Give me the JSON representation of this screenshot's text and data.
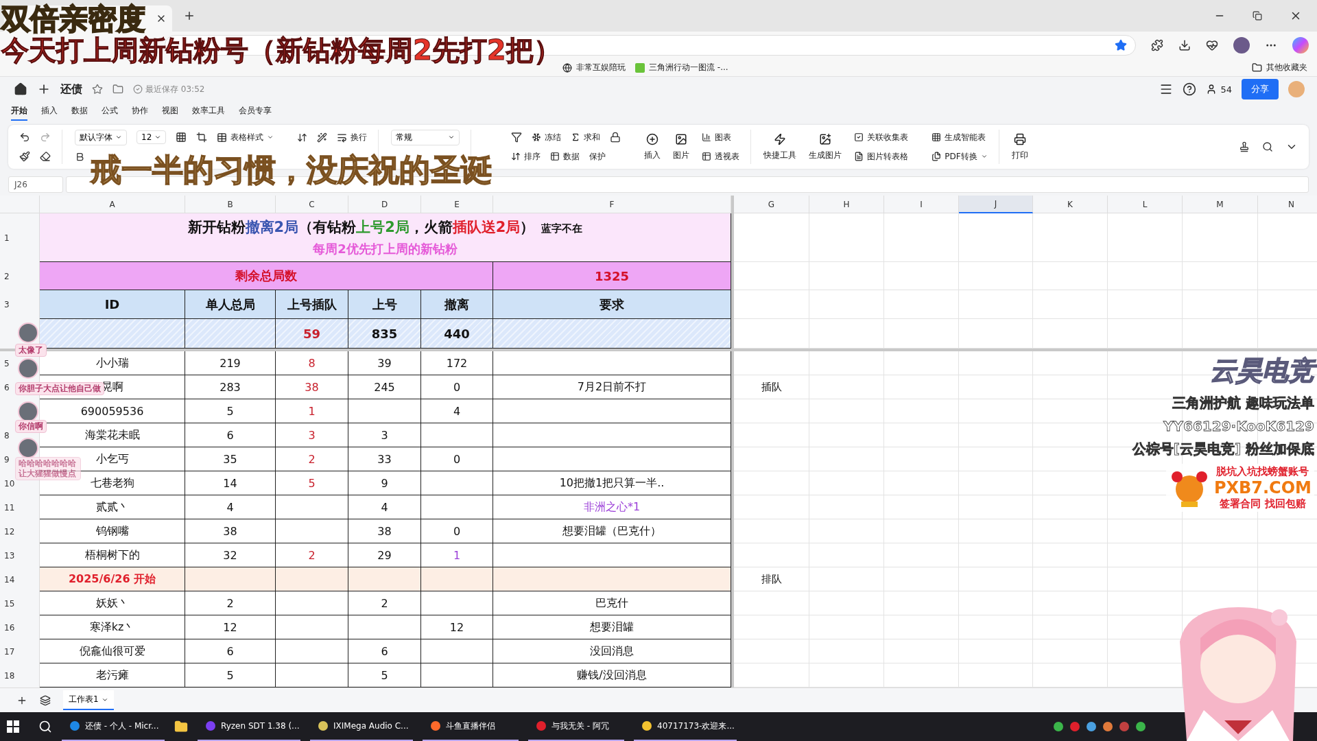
{
  "captions": [
    {
      "kind": "headline",
      "text": "双倍亲密度"
    },
    {
      "kind": "subline",
      "text": "今天打上周新钻粉号（新钻粉每周2先打2把）"
    },
    {
      "kind": "lyric",
      "text": "戒一半的习惯，没庆祝的圣诞"
    }
  ],
  "browser": {
    "bookmarks": [
      "非常互娱陪玩",
      "三角洲行动一图流 -..."
    ],
    "other_bookmarks": "其他收藏夹"
  },
  "doc": {
    "title": "还债",
    "saved": "最近保存 03:52",
    "collaborators": "54",
    "share": "分享"
  },
  "menu_tabs": [
    {
      "label": "开始",
      "selected": true
    },
    {
      "label": "插入",
      "selected": false
    },
    {
      "label": "数据",
      "selected": false
    },
    {
      "label": "公式",
      "selected": false
    },
    {
      "label": "协作",
      "selected": false
    },
    {
      "label": "视图",
      "selected": false
    },
    {
      "label": "效率工具",
      "selected": false
    },
    {
      "label": "会员专享",
      "selected": false
    }
  ],
  "toolbar": {
    "font": "默认字体",
    "font_size": "12",
    "table_style": "表格样式",
    "wrap": "换行",
    "number_format": "常规",
    "freeze": "冻结",
    "sum": "求和",
    "sort": "排序",
    "data": "数据",
    "protect": "保护",
    "insert": "插入",
    "picture": "图片",
    "chart": "图表",
    "pivot": "透视表",
    "quick_tools": "快捷工具",
    "make_image": "生成图片",
    "links": [
      "关联收集表",
      "图片转表格",
      "生成智能表",
      "PDF转换"
    ],
    "print": "打印"
  },
  "name_box": "J26",
  "sheet": {
    "columns": [
      {
        "label": "A",
        "selected": false
      },
      {
        "label": "B",
        "selected": false
      },
      {
        "label": "C",
        "selected": false
      },
      {
        "label": "D",
        "selected": false
      },
      {
        "label": "E",
        "selected": false
      },
      {
        "label": "F",
        "selected": false
      },
      {
        "label": "G",
        "selected": false
      },
      {
        "label": "H",
        "selected": false
      },
      {
        "label": "I",
        "selected": false
      },
      {
        "label": "J",
        "selected": true
      },
      {
        "label": "K",
        "selected": false
      },
      {
        "label": "L",
        "selected": false
      },
      {
        "label": "M",
        "selected": false
      },
      {
        "label": "N",
        "selected": false
      }
    ],
    "title": {
      "num": "1",
      "segments": [
        {
          "text": "新开钻粉",
          "color": "#111111"
        },
        {
          "text": "撤离2局",
          "color": "#3a55b0"
        },
        {
          "text": "（有钻粉",
          "color": "#111111"
        },
        {
          "text": "上号2局",
          "color": "#2f9a2f"
        },
        {
          "text": "，火箭",
          "color": "#111111"
        },
        {
          "text": "插队送2局",
          "color": "#e0202c"
        },
        {
          "text": "）",
          "color": "#111111"
        }
      ],
      "note": "蓝字不在",
      "subtitle": "每周2优先打上周的新钻粉"
    },
    "total": {
      "num": "2",
      "label": "剩余总局数",
      "value": "1325"
    },
    "headers": {
      "num": "3",
      "labels": [
        "ID",
        "单人总局",
        "上号插队",
        "上号",
        "撤离",
        "要求"
      ]
    },
    "summary": {
      "cells": [
        null,
        null,
        "59",
        "835",
        "440",
        null
      ]
    },
    "rows": [
      {
        "kind": "data",
        "num": "5",
        "cells": [
          "小小瑞",
          "219",
          "8",
          "39",
          "172",
          null
        ]
      },
      {
        "kind": "data",
        "num": "6",
        "cells": [
          "晃啊",
          "283",
          "38",
          "245",
          "0",
          "7月2日前不打"
        ],
        "side": "插队"
      },
      {
        "kind": "data",
        "cells": [
          "690059536",
          "5",
          "1",
          null,
          "4",
          null
        ]
      },
      {
        "kind": "data",
        "num": "8",
        "cells": [
          "海棠花未眠",
          "6",
          "3",
          "3",
          null,
          null
        ]
      },
      {
        "kind": "data",
        "num": "9",
        "cells": [
          "小乞丐",
          "35",
          "2",
          "33",
          "0",
          null
        ]
      },
      {
        "kind": "data",
        "num": "10",
        "cells": [
          "七巷老狗",
          "14",
          "5",
          "9",
          null,
          "10把撤1把只算一半.."
        ]
      },
      {
        "kind": "data",
        "num": "11",
        "cells": [
          "贰贰丶",
          "4",
          null,
          "4",
          null,
          {
            "text": "非洲之心*1",
            "color": "#9b3fd8"
          }
        ]
      },
      {
        "kind": "data",
        "num": "12",
        "cells": [
          "钨钢嘴",
          "38",
          null,
          "38",
          "0",
          "想要泪罐（巴克什）"
        ]
      },
      {
        "kind": "data",
        "num": "13",
        "cells": [
          "梧桐树下的",
          "32",
          "2",
          "29",
          {
            "text": "1",
            "color": "#9b3fd8"
          },
          null
        ]
      },
      {
        "kind": "section",
        "num": "14",
        "label": "2025/6/26 开始",
        "side": "排队"
      },
      {
        "kind": "data",
        "num": "15",
        "cells": [
          "妖妖丶",
          "2",
          null,
          "2",
          null,
          "巴克什"
        ]
      },
      {
        "kind": "data",
        "num": "16",
        "cells": [
          "寒泽kz丶",
          "12",
          null,
          null,
          "12",
          "想要泪罐"
        ]
      },
      {
        "kind": "data",
        "num": "17",
        "cells": [
          "倪龕仙很可爱",
          "6",
          null,
          "6",
          null,
          "没回消息"
        ]
      },
      {
        "kind": "data",
        "num": "18",
        "cells": [
          "老污瘫",
          "5",
          null,
          "5",
          null,
          "赚钱/没回消息"
        ]
      }
    ]
  },
  "sheet_tabs": [
    {
      "label": "工作表1",
      "selected": true
    }
  ],
  "chat": [
    {
      "text": "太像了",
      "faded": false
    },
    {
      "text": "你胆子大点让他自己做",
      "faded": false
    },
    {
      "text": "你信啊",
      "faded": false
    },
    {
      "lines": [
        "哈哈哈哈哈哈哈",
        "让大猩猩做慢点"
      ],
      "faded": true
    }
  ],
  "promo": {
    "brand": "云昊电竞",
    "lines": [
      "三角洲护航 趣味玩法单",
      "YY66129·KooK6129",
      "公棕号[云昊电竞] 粉丝加保底"
    ],
    "ad": {
      "top": "脱坑入坑找螃蟹账号",
      "site": "PXB7.COM",
      "bottom": "签署合同 找回包赔"
    }
  },
  "taskbar": [
    "还债 - 个人 - Micr...",
    "Ryzen SDT 1.38 (...",
    "IXIMega Audio C...",
    "斗鱼直播伴侣",
    "与我无关 - 阿冗",
    "40717173-欢迎来..."
  ]
}
